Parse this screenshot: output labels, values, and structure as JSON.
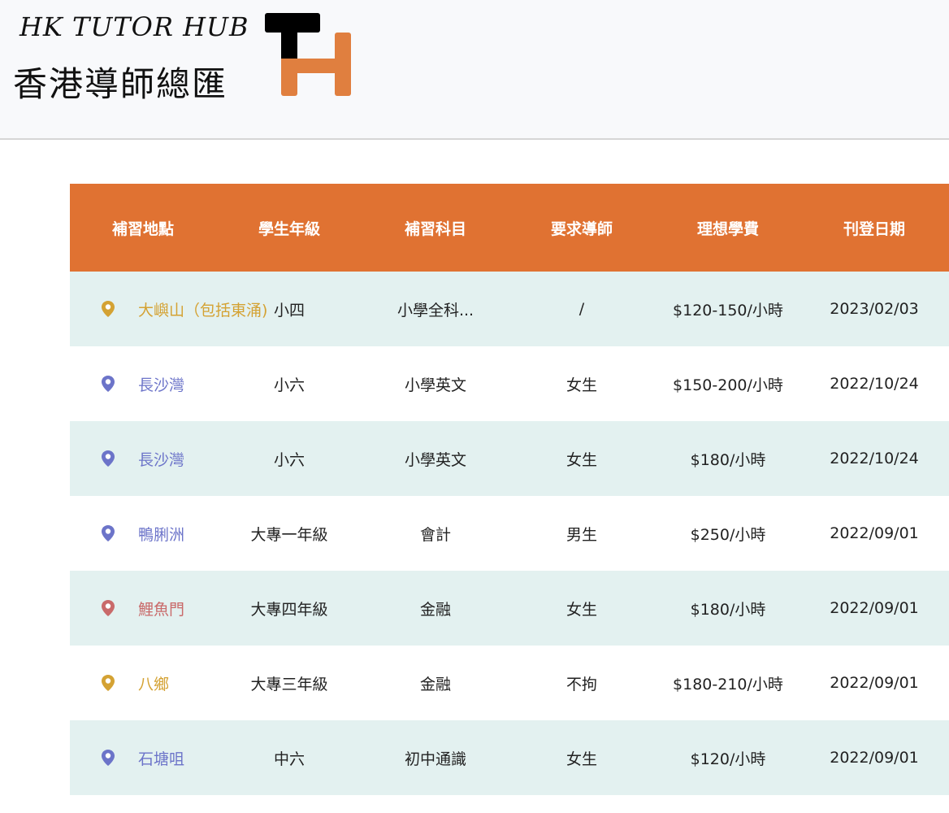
{
  "header": {
    "brand_en": "HK TUTOR HUB",
    "brand_zh": "香港導師總匯",
    "logo": "TH",
    "colors": {
      "logo_dark": "#000000",
      "logo_accent": "#e07f3f"
    }
  },
  "table": {
    "colors": {
      "header_bg": "#e07232",
      "row_even_bg": "#e3f1f0",
      "row_odd_bg": "#ffffff"
    },
    "columns": [
      "補習地點",
      "學生年級",
      "補習科目",
      "要求導師",
      "理想學費",
      "刊登日期"
    ],
    "rows": [
      {
        "location": "大嶼山（包括東涌)",
        "grade": "小四",
        "subject": "小學全科...",
        "tutor": "/",
        "fee": "$120-150/小時",
        "date": "2023/02/03",
        "pin_icon": "location-pin-icon",
        "loc_color": "#d4a233"
      },
      {
        "location": "長沙灣",
        "grade": "小六",
        "subject": "小學英文",
        "tutor": "女生",
        "fee": "$150-200/小時",
        "date": "2022/10/24",
        "pin_icon": "location-pin-icon",
        "loc_color": "#6c74c9"
      },
      {
        "location": "長沙灣",
        "grade": "小六",
        "subject": "小學英文",
        "tutor": "女生",
        "fee": "$180/小時",
        "date": "2022/10/24",
        "pin_icon": "location-pin-icon",
        "loc_color": "#6c74c9"
      },
      {
        "location": "鴨脷洲",
        "grade": "大專一年級",
        "subject": "會計",
        "tutor": "男生",
        "fee": "$250/小時",
        "date": "2022/09/01",
        "pin_icon": "location-pin-icon",
        "loc_color": "#6c74c9"
      },
      {
        "location": "鯉魚門",
        "grade": "大專四年級",
        "subject": "金融",
        "tutor": "女生",
        "fee": "$180/小時",
        "date": "2022/09/01",
        "pin_icon": "location-pin-icon",
        "loc_color": "#c96a6a"
      },
      {
        "location": "八鄉",
        "grade": "大專三年級",
        "subject": "金融",
        "tutor": "不拘",
        "fee": "$180-210/小時",
        "date": "2022/09/01",
        "pin_icon": "location-pin-icon",
        "loc_color": "#d4a233"
      },
      {
        "location": "石塘咀",
        "grade": "中六",
        "subject": "初中通識",
        "tutor": "女生",
        "fee": "$120/小時",
        "date": "2022/09/01",
        "pin_icon": "location-pin-icon",
        "loc_color": "#6c74c9"
      }
    ]
  }
}
